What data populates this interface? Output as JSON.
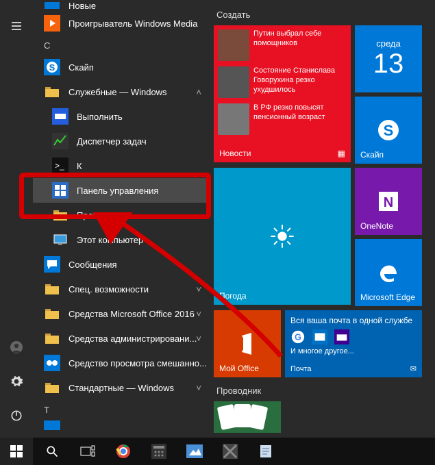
{
  "rail": {
    "hamburger": "≡",
    "user": "user-icon",
    "settings": "settings-icon",
    "power": "power-icon"
  },
  "apps": {
    "top": [
      {
        "id": "new",
        "label": "Новые",
        "icon": "square"
      },
      {
        "id": "wmp",
        "label": "Проигрыватель Windows Media",
        "icon": "wmp"
      }
    ],
    "letter_c": "С",
    "c_items": [
      {
        "id": "skype",
        "label": "Скайп",
        "icon": "skype"
      },
      {
        "id": "systools",
        "label": "Служебные — Windows",
        "icon": "folder",
        "expander": "up"
      },
      {
        "id": "run",
        "label": "Выполнить",
        "icon": "run",
        "indent": true
      },
      {
        "id": "taskmgr",
        "label": "Диспетчер задач",
        "icon": "taskmgr",
        "indent": true
      },
      {
        "id": "cmd",
        "label": "К",
        "icon": "cmd",
        "indent": true
      },
      {
        "id": "cpanel",
        "label": "Панель управления",
        "icon": "cpanel",
        "indent": true,
        "highlight": true
      },
      {
        "id": "explorer",
        "label": "Проводник",
        "icon": "explorer",
        "indent": true
      },
      {
        "id": "thispc",
        "label": "Этот компьютер",
        "icon": "thispc",
        "indent": true
      },
      {
        "id": "msgs",
        "label": "Сообщения",
        "icon": "msgs"
      },
      {
        "id": "access",
        "label": "Спец. возможности",
        "icon": "folder",
        "expander": "down"
      },
      {
        "id": "office",
        "label": "Средства Microsoft Office 2016",
        "icon": "folder",
        "expander": "down"
      },
      {
        "id": "admin",
        "label": "Средства администрировани...",
        "icon": "folder",
        "expander": "down"
      },
      {
        "id": "mixed",
        "label": "Средство просмотра смешанно...",
        "icon": "mixed"
      },
      {
        "id": "std",
        "label": "Стандартные — Windows",
        "icon": "folder",
        "expander": "down"
      }
    ],
    "letter_t": "Т",
    "t_items": [
      {
        "id": "t1",
        "label": "",
        "icon": "square"
      }
    ]
  },
  "tiles": {
    "header": "Создать",
    "news_items": [
      "Путин выбрал себе помощников",
      "Состояние Станислава Говорухина резко ухудшилось",
      "В РФ резко повысят пенсионный возраст"
    ],
    "news_label": "Новости",
    "calendar_day": "среда",
    "calendar_date": "13",
    "skype_label": "Скайп",
    "onenote_label": "OneNote",
    "weather_label": "Погода",
    "edge_label": "Microsoft Edge",
    "office_label": "Мой Office",
    "mail_label": "Почта",
    "mail_headline": "Вся ваша почта в одной службе",
    "mail_sub": "И многое другое...",
    "explorer_header": "Проводник"
  },
  "taskbar": {
    "start": "start-icon",
    "search": "search-icon",
    "taskview": "taskview-icon",
    "items": [
      "chrome",
      "calc",
      "photos",
      "app1",
      "notes"
    ]
  }
}
